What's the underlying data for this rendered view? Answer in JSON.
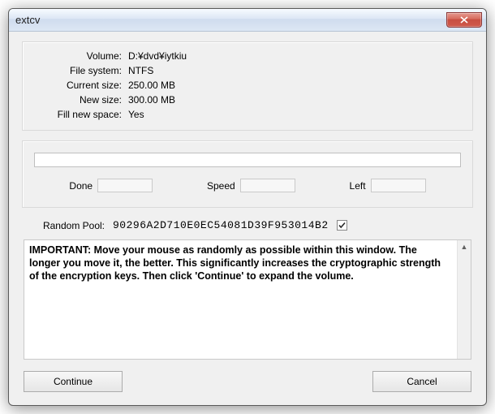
{
  "titlebar": {
    "title": "extcv"
  },
  "info": {
    "labels": {
      "volume": "Volume:",
      "file_system": "File system:",
      "current_size": "Current size:",
      "new_size": "New size:",
      "fill_new_space": "Fill new space:"
    },
    "values": {
      "volume": "D:¥dvd¥iytkiu",
      "file_system": "NTFS",
      "current_size": "250.00 MB",
      "new_size": "300.00 MB",
      "fill_new_space": "Yes"
    }
  },
  "progress": {
    "labels": {
      "done": "Done",
      "speed": "Speed",
      "left": "Left"
    },
    "values": {
      "done": "",
      "speed": "",
      "left": ""
    }
  },
  "random_pool": {
    "label": "Random Pool:",
    "value": "90296A2D710E0EC54081D39F953014B2",
    "show_checked": true
  },
  "instructions": "IMPORTANT: Move your mouse as randomly as possible within this window. The longer you move it, the better. This significantly increases the cryptographic strength of the encryption keys. Then click 'Continue' to expand the volume.",
  "buttons": {
    "continue": "Continue",
    "cancel": "Cancel"
  }
}
